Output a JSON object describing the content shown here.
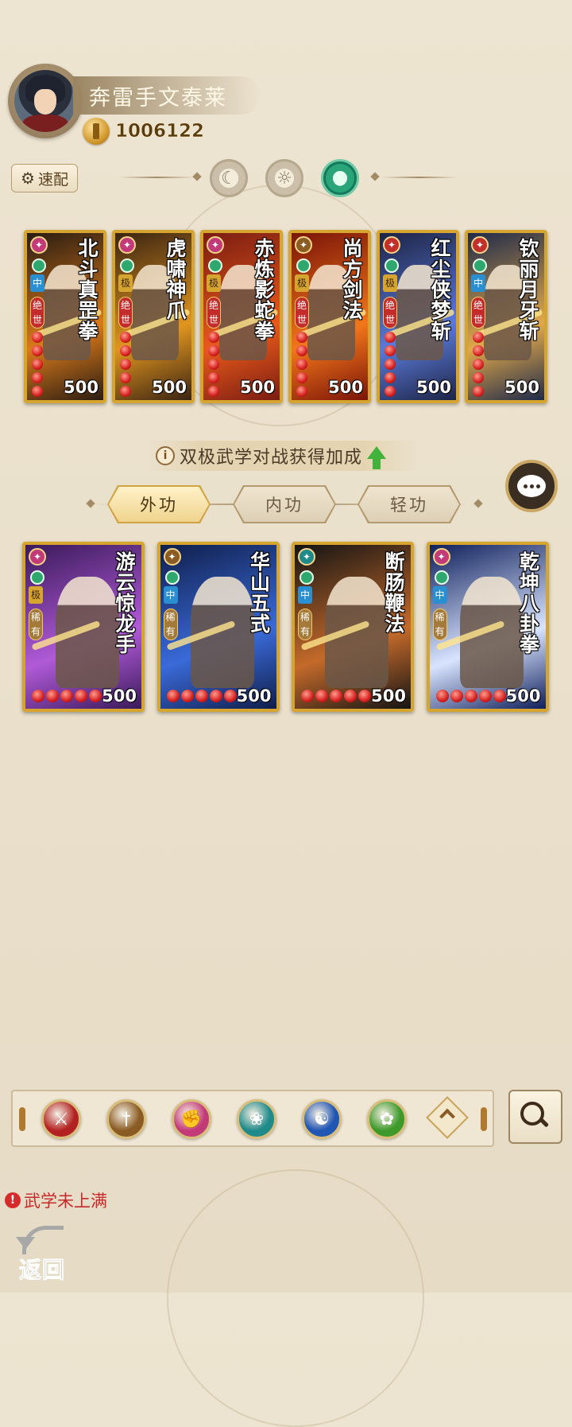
{
  "player": {
    "name": "奔雷手文泰莱",
    "coins": "1006122"
  },
  "header": {
    "speed_config_label": "速配"
  },
  "phase_tabs": [
    {
      "icon": "moon-icon",
      "active": false
    },
    {
      "icon": "sun-icon",
      "active": false
    },
    {
      "icon": "jade-ring-icon",
      "active": true
    }
  ],
  "equipped_skills": [
    {
      "title": "北斗真罡拳",
      "level": "中",
      "rank": "绝世",
      "value": "500",
      "type_color": "#c23b78",
      "bg": [
        "#2a1c12",
        "#d97a1a"
      ]
    },
    {
      "title": "虎啸神爪",
      "level": "极",
      "rank": "绝世",
      "value": "500",
      "type_color": "#c23b78",
      "bg": [
        "#3b2412",
        "#e0951f"
      ]
    },
    {
      "title": "赤炼影蛇拳",
      "level": "极",
      "rank": "绝世",
      "value": "500",
      "type_color": "#c23b78",
      "bg": [
        "#7a1c12",
        "#e85a1a"
      ]
    },
    {
      "title": "尚方剑法",
      "level": "极",
      "rank": "绝世",
      "value": "500",
      "type_color": "#8a5b22",
      "bg": [
        "#7a1408",
        "#f2761a"
      ]
    },
    {
      "title": "红尘侠梦斩",
      "level": "极",
      "rank": "绝世",
      "value": "500",
      "type_color": "#c2302b",
      "bg": [
        "#1d2446",
        "#5a7ad8"
      ]
    },
    {
      "title": "钦丽月牙斩",
      "level": "中",
      "rank": "绝世",
      "value": "500",
      "type_color": "#c2302b",
      "bg": [
        "#1f2a4a",
        "#e0a84a"
      ]
    }
  ],
  "bonus_info": {
    "text": "双极武学对战获得加成",
    "icon": "i"
  },
  "category_tabs": [
    {
      "label": "外功",
      "active": true
    },
    {
      "label": "内功",
      "active": false
    },
    {
      "label": "轻功",
      "active": false
    }
  ],
  "skill_list": [
    {
      "title": "游云惊龙手",
      "level": "极",
      "rank": "稀有",
      "value": "500",
      "type_color": "#c23b78",
      "bg": [
        "#3a1a5a",
        "#b05ad8"
      ]
    },
    {
      "title": "华山五式",
      "level": "中",
      "rank": "稀有",
      "value": "500",
      "type_color": "#8a5b22",
      "bg": [
        "#0f1e4a",
        "#3a6ad8"
      ]
    },
    {
      "title": "断肠鞭法",
      "level": "中",
      "rank": "稀有",
      "value": "500",
      "type_color": "#1f8a8a",
      "bg": [
        "#141414",
        "#c46a2a"
      ]
    },
    {
      "title": "乾坤八卦拳",
      "level": "中",
      "rank": "稀有",
      "value": "500",
      "type_color": "#c23b78",
      "bg": [
        "#0f1f5a",
        "#d8e4ff"
      ]
    }
  ],
  "filters": [
    {
      "icon": "blade-icon",
      "color": "#b32222"
    },
    {
      "icon": "sword-icon",
      "color": "#8a5b22"
    },
    {
      "icon": "fist-icon",
      "color": "#c23b78"
    },
    {
      "icon": "fan-icon",
      "color": "#1f8a8a"
    },
    {
      "icon": "yinyang-icon",
      "color": "#1f55b3"
    },
    {
      "icon": "swirl-icon",
      "color": "#3d9a2a"
    }
  ],
  "footer": {
    "warning": "武学未上满",
    "back_label": "返回"
  }
}
